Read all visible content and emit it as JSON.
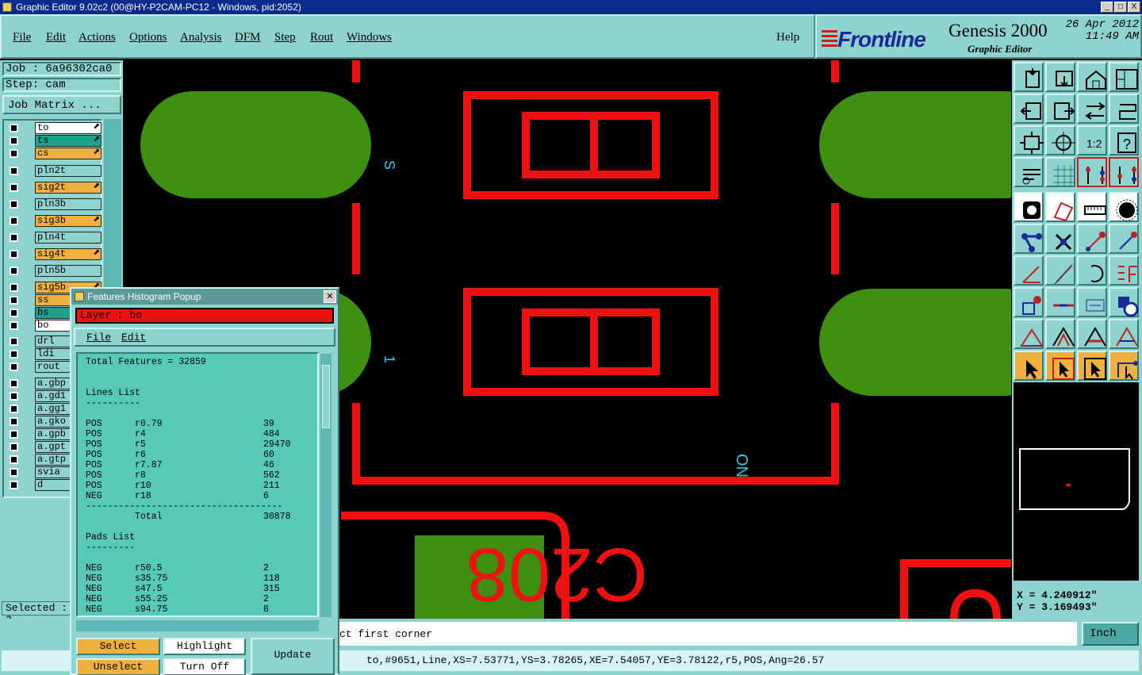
{
  "window": {
    "title": "Graphic Editor 9.02c2 (00@HY-P2CAM-PC12 - Windows, pid:2052)",
    "buttons": [
      "_",
      "□",
      "X"
    ]
  },
  "menu": {
    "items": [
      "File",
      "Edit",
      "Actions",
      "Options",
      "Analysis",
      "DFM",
      "Step",
      "Rout",
      "Windows"
    ],
    "help": "Help"
  },
  "brand": {
    "logo": "Frontline",
    "product": "Genesis 2000",
    "subtitle": "Graphic Editor",
    "date": "26 Apr 2012",
    "time": "11:49 AM"
  },
  "job": {
    "job": "Job  : 6a96302ca0",
    "step": "Step: cam",
    "matrix_button": "Job Matrix ..."
  },
  "layers": [
    {
      "name": "to",
      "color": "#ffffff",
      "arrow": true
    },
    {
      "name": "ts",
      "color": "#1fa08a",
      "arrow": true
    },
    {
      "name": "cs",
      "color": "#f0b040",
      "arrow": true
    },
    {
      "name": "pln2t",
      "color": "#8fd3ce",
      "arrow": false
    },
    {
      "name": "sig2t",
      "color": "#f0b040",
      "arrow": true
    },
    {
      "name": "pln3b",
      "color": "#8fd3ce",
      "arrow": false
    },
    {
      "name": "sig3b",
      "color": "#f0b040",
      "arrow": true
    },
    {
      "name": "pln4t",
      "color": "#8fd3ce",
      "arrow": false
    },
    {
      "name": "sig4t",
      "color": "#f0b040",
      "arrow": true
    },
    {
      "name": "pln5b",
      "color": "#8fd3ce",
      "arrow": false
    },
    {
      "name": "sig5b",
      "color": "#f0b040",
      "arrow": true
    },
    {
      "name": "ss",
      "color": "#f0b040",
      "arrow": false
    },
    {
      "name": "bs",
      "color": "#1fa08a",
      "arrow": false
    },
    {
      "name": "bo",
      "color": "#ffffff",
      "arrow": false
    },
    {
      "name": "drl",
      "color": "#8fd3ce",
      "arrow": false
    },
    {
      "name": "ldi",
      "color": "#8fd3ce",
      "arrow": false
    },
    {
      "name": "rout",
      "color": "#8fd3ce",
      "arrow": false
    },
    {
      "name": "a.gbp",
      "color": "#8fd3ce",
      "arrow": false
    },
    {
      "name": "a.gd1",
      "color": "#8fd3ce",
      "arrow": false
    },
    {
      "name": "a.gg1",
      "color": "#8fd3ce",
      "arrow": false
    },
    {
      "name": "a.gko",
      "color": "#8fd3ce",
      "arrow": false
    },
    {
      "name": "a.gpb",
      "color": "#8fd3ce",
      "arrow": false
    },
    {
      "name": "a.gpt",
      "color": "#8fd3ce",
      "arrow": false
    },
    {
      "name": "a.gtp",
      "color": "#8fd3ce",
      "arrow": false
    },
    {
      "name": "svia",
      "color": "#8fd3ce",
      "arrow": false
    },
    {
      "name": "d",
      "color": "#8fd3ce",
      "arrow": false
    }
  ],
  "selected": "Selected : 3",
  "popup": {
    "title": "Features Histogram Popup",
    "layer": "Layer :  bo",
    "menu": [
      "File",
      "Edit"
    ],
    "total_features": "Total Features = 32859",
    "lines_title": "Lines List",
    "underline_short": "----------",
    "lines": [
      [
        "POS",
        "r0.79",
        "39"
      ],
      [
        "POS",
        "r4",
        "484"
      ],
      [
        "POS",
        "r5",
        "29470"
      ],
      [
        "POS",
        "r6",
        "60"
      ],
      [
        "POS",
        "r7.87",
        "46"
      ],
      [
        "POS",
        "r8",
        "562"
      ],
      [
        "POS",
        "r10",
        "211"
      ],
      [
        "NEG",
        "r18",
        "6"
      ]
    ],
    "separator": "------------------------------------",
    "total_label": "Total",
    "total_value": "30878",
    "pads_title": "Pads List",
    "underline_pads": "---------",
    "pads": [
      [
        "NEG",
        "r50.5",
        "2"
      ],
      [
        "NEG",
        "s35.75",
        "118"
      ],
      [
        "NEG",
        "s47.5",
        "315"
      ],
      [
        "NEG",
        "s55.25",
        "2"
      ],
      [
        "NEG",
        "s94.75",
        "8"
      ]
    ],
    "buttons": {
      "select": "Select",
      "highlight": "Highlight",
      "update": "Update",
      "unselect": "Unselect",
      "turn_off": "Turn Off"
    }
  },
  "canvas_text": {
    "s": "S",
    "one": "1",
    "on": "ON",
    "part": "C208"
  },
  "prompt": "ct first corner",
  "units": "Inch",
  "status": "to,#9651,Line,XS=7.53771,YS=3.78265,XE=7.54057,YE=3.78122,r5,POS,Ang=26.57",
  "coords": {
    "x": "X  = 4.240912\"",
    "y": "Y  = 3.169493\""
  },
  "colors": {
    "copper": "#3f8f10",
    "silk": "#ee1111",
    "accent": "#8fd3ce",
    "text_cyan": "#30c8e8"
  }
}
